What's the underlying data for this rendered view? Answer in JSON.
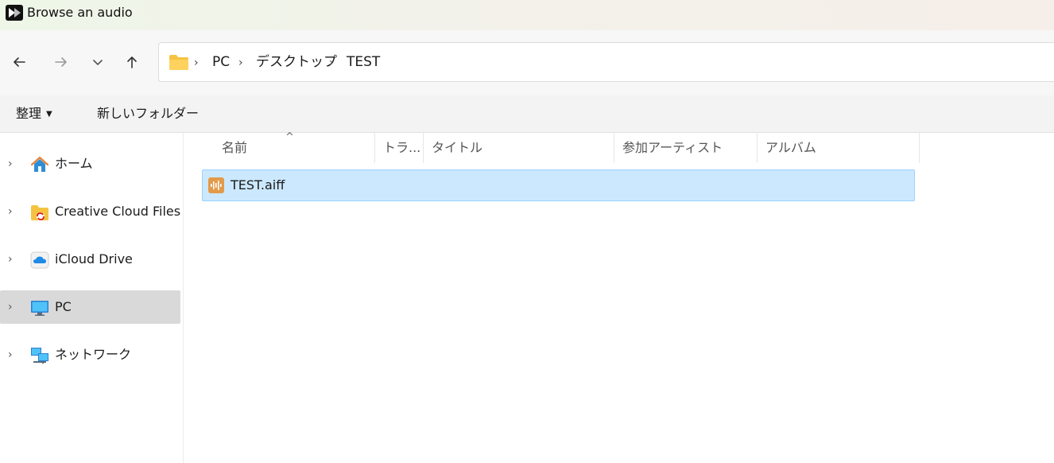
{
  "window": {
    "title": "Browse an audio"
  },
  "nav": {
    "back": "back-icon",
    "forward": "forward-icon",
    "recent": "chevron-down-icon",
    "up": "up-icon"
  },
  "breadcrumb": {
    "items": [
      "PC",
      "デスクトップ",
      "TEST"
    ],
    "separator": "›"
  },
  "toolbar": {
    "organize_label": "整理",
    "organize_caret": "▼",
    "new_folder_label": "新しいフォルダー"
  },
  "sidebar": {
    "items": [
      {
        "label": "ホーム",
        "icon": "home-icon"
      },
      {
        "label": "Creative Cloud Files",
        "icon": "creative-cloud-folder-icon"
      },
      {
        "label": "iCloud Drive",
        "icon": "icloud-icon"
      },
      {
        "label": "PC",
        "icon": "monitor-icon",
        "selected": true
      },
      {
        "label": "ネットワーク",
        "icon": "network-icon"
      }
    ],
    "chevron": "›"
  },
  "columns": [
    {
      "label": "名前"
    },
    {
      "label": "トラ..."
    },
    {
      "label": "タイトル"
    },
    {
      "label": "参加アーティスト"
    },
    {
      "label": "アルバム"
    }
  ],
  "sort_indicator": "^",
  "files": [
    {
      "name": "TEST.aiff",
      "icon": "audio-file-icon",
      "selected": true
    }
  ],
  "colors": {
    "selection": "#cce8ff",
    "selection_border": "#99d1ff",
    "sidebar_selected": "#d9d9d9",
    "folder": "#f5c342",
    "audio_icon": "#e29a4a"
  }
}
